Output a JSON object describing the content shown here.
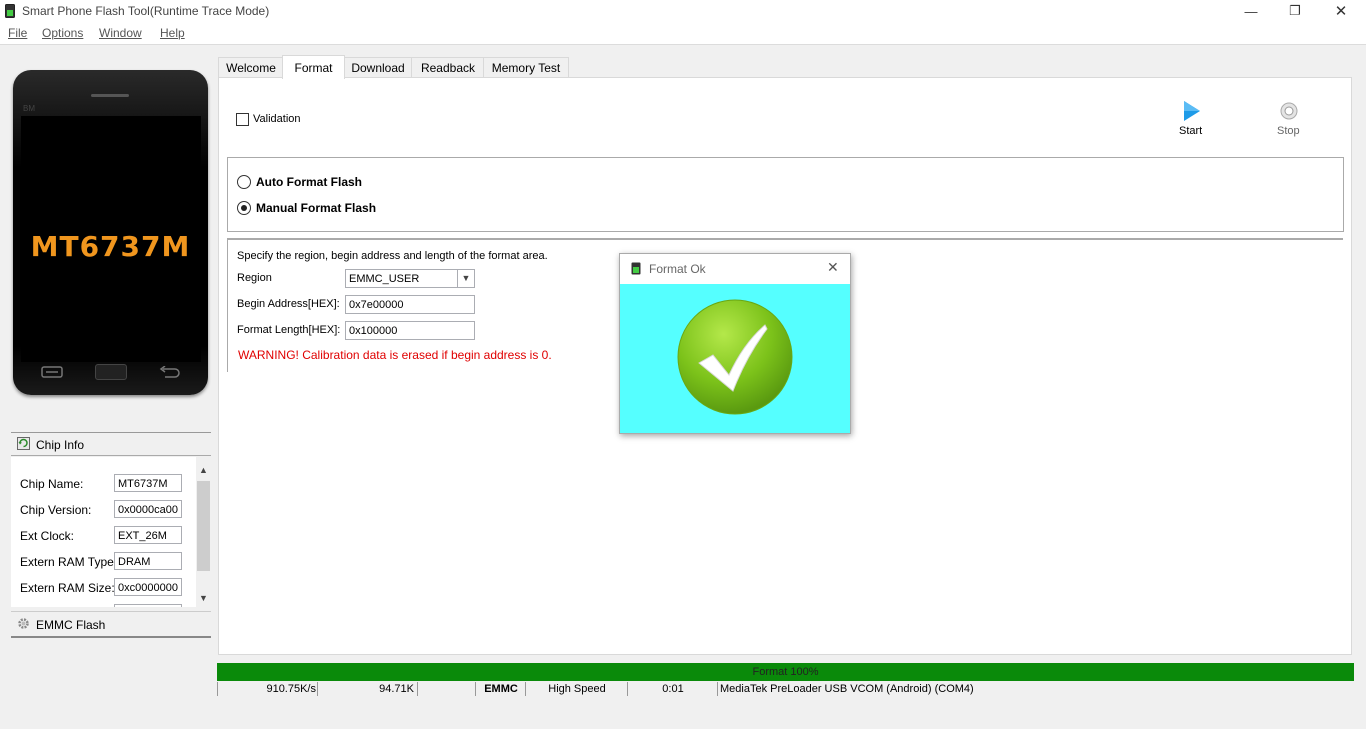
{
  "window": {
    "title": "Smart Phone Flash Tool(Runtime Trace Mode)",
    "minimize": "—",
    "maximize": "❐",
    "close": "✕"
  },
  "menu": [
    "File",
    "Options",
    "Window",
    "Help"
  ],
  "phone": {
    "chip": "MT6737M",
    "brand": "BM"
  },
  "chip_info": {
    "title": "Chip Info",
    "rows": [
      {
        "label": "Chip Name:",
        "value": "MT6737M"
      },
      {
        "label": "Chip Version:",
        "value": "0x0000ca00"
      },
      {
        "label": "Ext Clock:",
        "value": "EXT_26M"
      },
      {
        "label": "Extern RAM Type:",
        "value": "DRAM"
      },
      {
        "label": "Extern RAM Size:",
        "value": "0xc0000000"
      }
    ],
    "emmc": "EMMC Flash"
  },
  "tabs": [
    "Welcome",
    "Format",
    "Download",
    "Readback",
    "Memory Test"
  ],
  "active_tab": "Format",
  "format": {
    "validation_label": "Validation",
    "start_label": "Start",
    "stop_label": "Stop",
    "auto_label": "Auto Format Flash",
    "manual_label": "Manual Format Flash",
    "selected_mode": "Manual Format Flash",
    "instruction": "Specify the region, begin address and length of the format area.",
    "region_label": "Region",
    "region_value": "EMMC_USER",
    "begin_label": "Begin Address[HEX]:",
    "begin_value": "0x7e00000",
    "length_label": "Format Length[HEX]:",
    "length_value": "0x100000",
    "warning": "WARNING! Calibration data is erased if begin address is 0."
  },
  "dialog": {
    "title": "Format Ok"
  },
  "progress": {
    "label": "Format 100%",
    "percent": 100
  },
  "status": {
    "speed": "910.75K/s",
    "size": "94.71K",
    "storage": "EMMC",
    "mode": "High Speed",
    "time": "0:01",
    "port": "MediaTek PreLoader USB VCOM (Android) (COM4)"
  },
  "colors": {
    "progress": "#0a8a0a",
    "warning": "#e00000",
    "chip_text": "#f0961e",
    "dialog_bg": "#55ffff",
    "check_green": "#7cc21a",
    "play_blue": "#1e9be8"
  }
}
